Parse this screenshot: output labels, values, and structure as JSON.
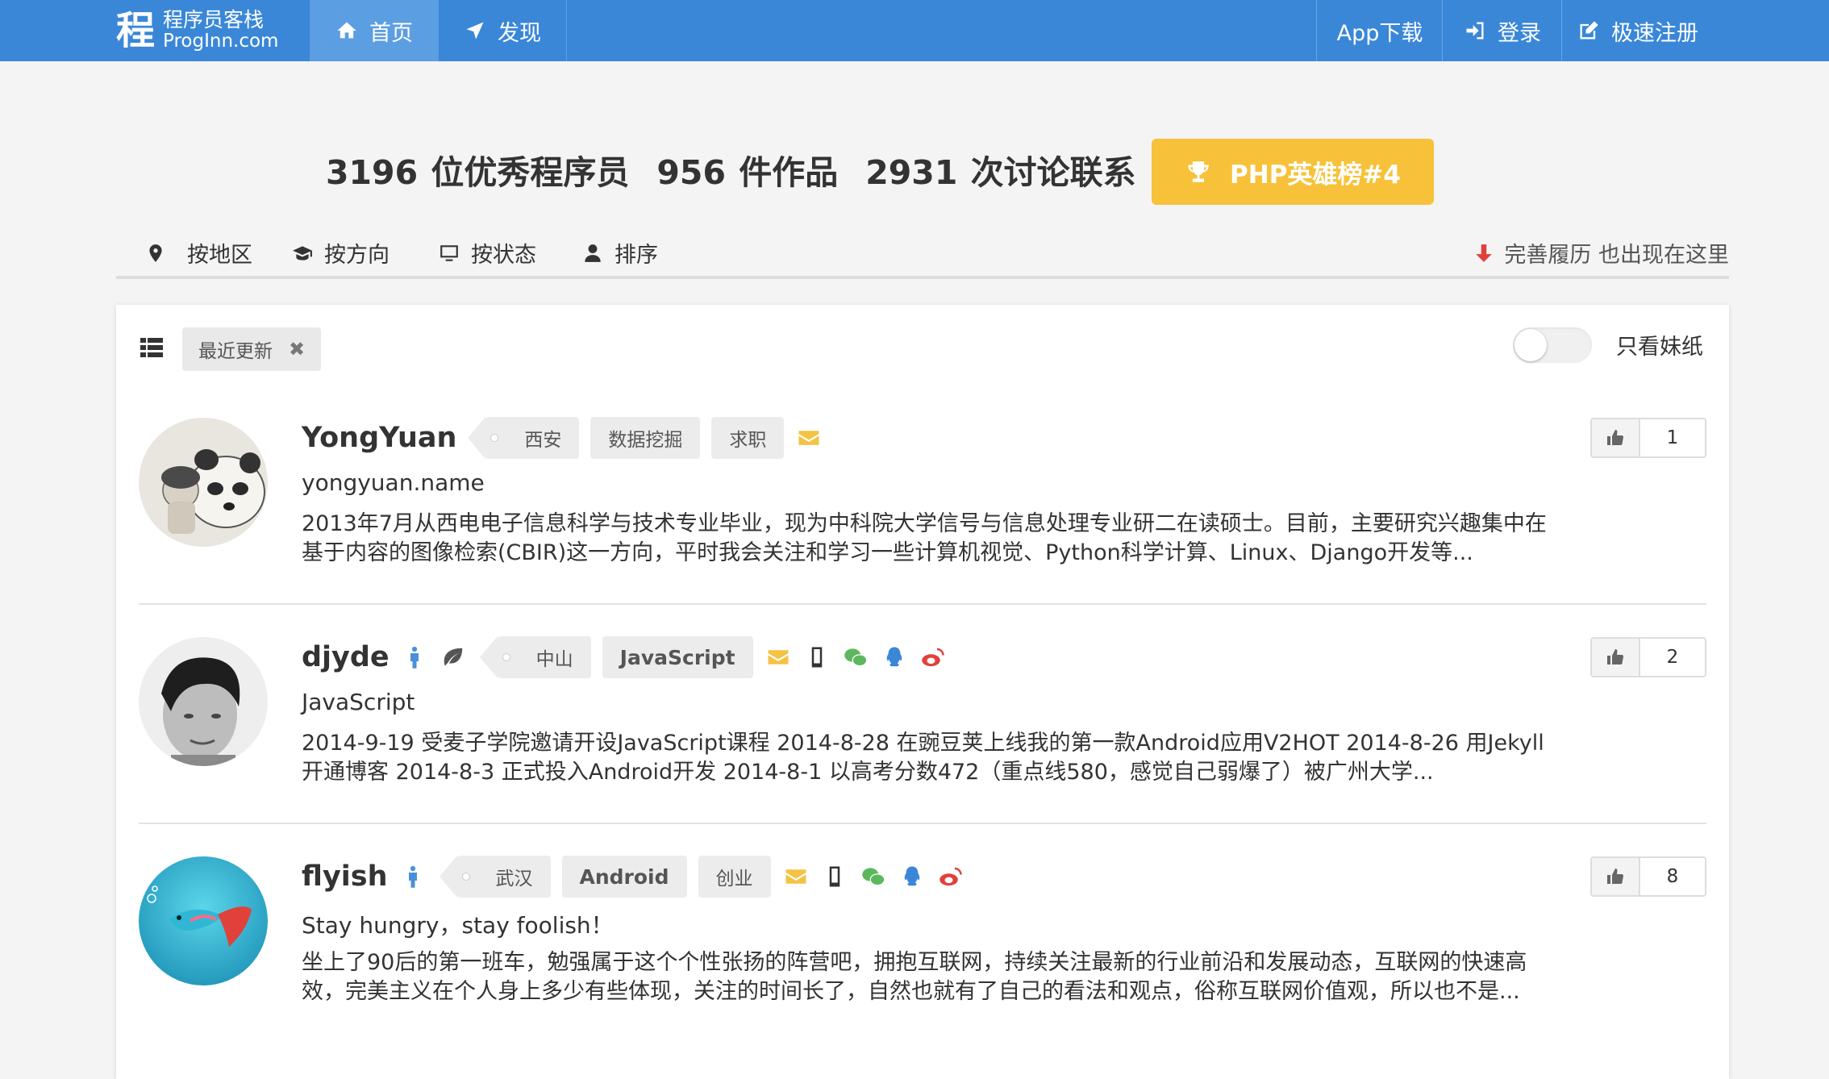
{
  "brand": {
    "mark": "程",
    "name_cn": "程序员客栈",
    "name_en": "ProgInn.com"
  },
  "nav": {
    "home": "首页",
    "discover": "发现",
    "app": "App下载",
    "login": "登录",
    "register": "极速注册"
  },
  "stats": {
    "programmers": "3196 位优秀程序员",
    "works": "956 件作品",
    "discussions": "2931 次讨论联系"
  },
  "hero_button": "PHP英雄榜#4",
  "filters": {
    "region": "按地区",
    "direction": "按方向",
    "status": "按状态",
    "sort": "排序",
    "resume_link": "完善履历 也出现在这里"
  },
  "list": {
    "chip": "最近更新",
    "chip_close": "✖",
    "toggle_label": "只看妹纸"
  },
  "users": [
    {
      "name": "YongYuan",
      "location": "西安",
      "tags": [
        "数据挖掘",
        "求职"
      ],
      "headline": "yongyuan.name",
      "description": "2013年7月从西电电子信息科学与技术专业毕业，现为中科院大学信号与信息处理专业研二在读硕士。目前，主要研究兴趣集中在基于内容的图像检索(CBIR)这一方向，平时我会关注和学习一些计算机视觉、Python科学计算、Linux、Django开发等...",
      "likes": "1"
    },
    {
      "name": "djyde",
      "location": "中山",
      "tags": [
        "JavaScript"
      ],
      "headline": "JavaScript",
      "description": "2014-9-19 受麦子学院邀请开设JavaScript课程 2014-8-28 在豌豆荚上线我的第一款Android应用V2HOT 2014-8-26 用Jekyll开通博客 2014-8-3 正式投入Android开发 2014-8-1 以高考分数472（重点线580，感觉自己弱爆了）被广州大学...",
      "likes": "2"
    },
    {
      "name": "flyish",
      "location": "武汉",
      "tags": [
        "Android",
        "创业"
      ],
      "headline": "Stay hungry，stay foolish！",
      "description": "坐上了90后的第一班车，勉强属于这个个性张扬的阵营吧，拥抱互联网，持续关注最新的行业前沿和发展动态，互联网的快速高效，完美主义在个人身上多少有些体现，关注的时间长了，自然也就有了自己的看法和观点，俗称互联网价值观，所以也不是...",
      "likes": "8"
    }
  ],
  "colors": {
    "nav_bg": "#3a87d8",
    "nav_active": "#5c9ee2",
    "hero_button": "#f7c23a",
    "mail_icon": "#f4c244",
    "wechat_icon": "#5cb85c",
    "qq_icon": "#3a87d8",
    "weibo_icon": "#e0413b"
  }
}
